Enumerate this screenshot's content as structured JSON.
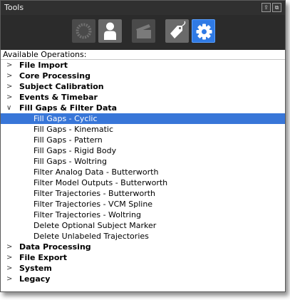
{
  "window": {
    "title": "Tools"
  },
  "title_buttons": {
    "pin": "⇪",
    "float": "⧉"
  },
  "toolbar": {
    "tools": [
      {
        "name": "circle-tool",
        "icon": "ring-icon",
        "state": "disabled"
      },
      {
        "name": "subject-tool",
        "icon": "person-icon",
        "state": "normal"
      },
      {
        "name": "clapper-tool",
        "icon": "clapperboard-icon",
        "state": "disabled"
      },
      {
        "name": "label-tool",
        "icon": "tags-icon",
        "state": "normal"
      },
      {
        "name": "settings-tool",
        "icon": "gear-icon",
        "state": "active"
      }
    ]
  },
  "operations_label": "Available Operations:",
  "tree": {
    "categories": [
      {
        "label": "File Import",
        "expander": ">",
        "expanded": false
      },
      {
        "label": "Core Processing",
        "expander": ">",
        "expanded": false
      },
      {
        "label": "Subject Calibration",
        "expander": ">",
        "expanded": false
      },
      {
        "label": "Events & Timebar",
        "expander": ">",
        "expanded": false
      },
      {
        "label": "Fill Gaps & Filter Data",
        "expander": "∨",
        "expanded": true,
        "children": [
          {
            "label": "Fill Gaps - Cyclic",
            "selected": true
          },
          {
            "label": "Fill Gaps - Kinematic"
          },
          {
            "label": "Fill Gaps - Pattern"
          },
          {
            "label": "Fill Gaps - Rigid Body"
          },
          {
            "label": "Fill Gaps - Woltring"
          },
          {
            "label": "Filter Analog Data - Butterworth"
          },
          {
            "label": "Filter Model Outputs - Butterworth"
          },
          {
            "label": "Filter Trajectories - Butterworth"
          },
          {
            "label": "Filter Trajectories - VCM Spline"
          },
          {
            "label": "Filter Trajectories - Woltring"
          },
          {
            "label": "Delete Optional Subject Marker"
          },
          {
            "label": "Delete Unlabeled Trajectories"
          }
        ]
      },
      {
        "label": "Data Processing",
        "expander": ">",
        "expanded": false
      },
      {
        "label": "File Export",
        "expander": ">",
        "expanded": false
      },
      {
        "label": "System",
        "expander": ">",
        "expanded": false
      },
      {
        "label": "Legacy",
        "expander": ">",
        "expanded": false
      }
    ]
  },
  "colors": {
    "selection": "#3876d8",
    "active_tool": "#2f7ae5",
    "toolbar_bg": "#2b2b2b"
  }
}
